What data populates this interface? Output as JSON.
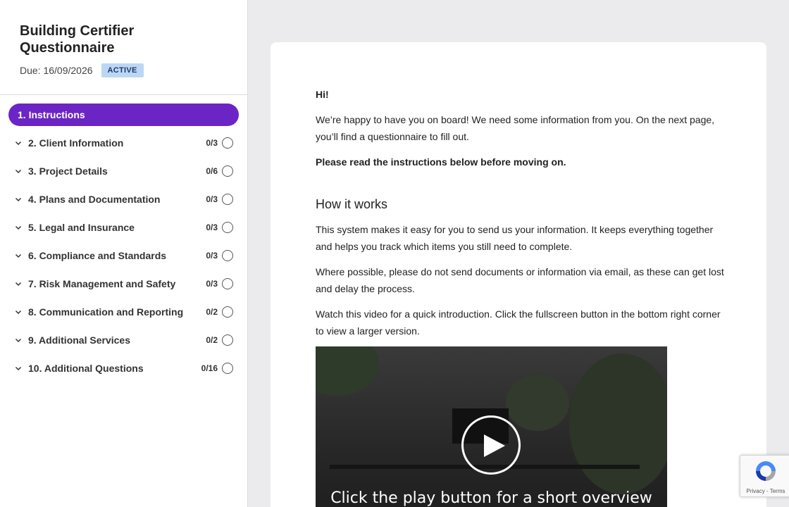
{
  "sidebar": {
    "title": "Building Certifier Questionnaire",
    "due": "Due: 16/09/2026",
    "status": "ACTIVE",
    "active_item": "1. Instructions",
    "items": [
      {
        "label": "2. Client Information",
        "count": "0/3"
      },
      {
        "label": "3. Project Details",
        "count": "0/6"
      },
      {
        "label": "4. Plans and Documentation",
        "count": "0/3"
      },
      {
        "label": "5. Legal and Insurance",
        "count": "0/3"
      },
      {
        "label": "6. Compliance and Standards",
        "count": "0/3"
      },
      {
        "label": "7. Risk Management and Safety",
        "count": "0/3"
      },
      {
        "label": "8. Communication and Reporting",
        "count": "0/2"
      },
      {
        "label": "9. Additional Services",
        "count": "0/2"
      },
      {
        "label": "10. Additional Questions",
        "count": "0/16"
      }
    ]
  },
  "main": {
    "greeting": "Hi!",
    "intro": "We’re happy to have you on board! We need some information from you. On the next page, you’ll find a questionnaire to fill out.",
    "instruction_note": "Please read the instructions below before moving on.",
    "heading": "How it works",
    "para1": "This system makes it easy for you to send us your information. It keeps everything together and helps you track which items you still need to complete.",
    "para2": "Where possible, please do not send documents or information via email, as these can get lost and delay the process.",
    "para3": "Watch this video for a quick introduction. Click the fullscreen button in the bottom right corner to view a larger version.",
    "video_caption": "Click the play button for a short overview"
  },
  "recaptcha": {
    "text": "Privacy - Terms"
  },
  "colors": {
    "accent": "#6b25c4",
    "badge_bg": "#bcd7f5"
  }
}
